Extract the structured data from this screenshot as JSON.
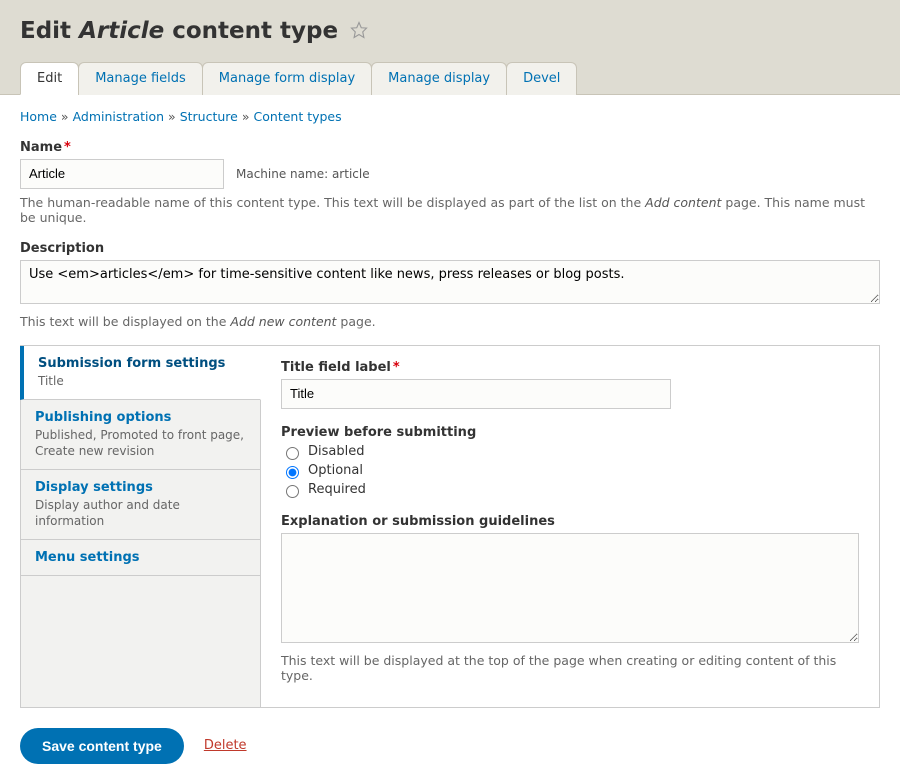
{
  "header": {
    "title_prefix": "Edit",
    "title_em": "Article",
    "title_suffix": "content type"
  },
  "tabs": [
    {
      "label": "Edit",
      "active": true
    },
    {
      "label": "Manage fields"
    },
    {
      "label": "Manage form display"
    },
    {
      "label": "Manage display"
    },
    {
      "label": "Devel"
    }
  ],
  "breadcrumb": {
    "items": [
      "Home",
      "Administration",
      "Structure",
      "Content types"
    ]
  },
  "name": {
    "label": "Name",
    "value": "Article",
    "machine_label": "Machine name:",
    "machine_value": "article",
    "help_before": "The human-readable name of this content type. This text will be displayed as part of the list on the ",
    "help_em": "Add content",
    "help_after": " page. This name must be unique."
  },
  "description": {
    "label": "Description",
    "value": "Use <em>articles</em> for time-sensitive content like news, press releases or blog posts.",
    "help_before": "This text will be displayed on the ",
    "help_em": "Add new content",
    "help_after": " page."
  },
  "vtabs": {
    "items": [
      {
        "title": "Submission form settings",
        "summary": "Title",
        "active": true
      },
      {
        "title": "Publishing options",
        "summary": "Published, Promoted to front page, Create new revision"
      },
      {
        "title": "Display settings",
        "summary": "Display author and date information"
      },
      {
        "title": "Menu settings",
        "summary": ""
      }
    ]
  },
  "submission": {
    "title_label": "Title field label",
    "title_value": "Title",
    "preview_label": "Preview before submitting",
    "preview_options": [
      "Disabled",
      "Optional",
      "Required"
    ],
    "preview_selected": "Optional",
    "guidelines_label": "Explanation or submission guidelines",
    "guidelines_value": "",
    "guidelines_help": "This text will be displayed at the top of the page when creating or editing content of this type."
  },
  "actions": {
    "save": "Save content type",
    "delete": "Delete"
  }
}
